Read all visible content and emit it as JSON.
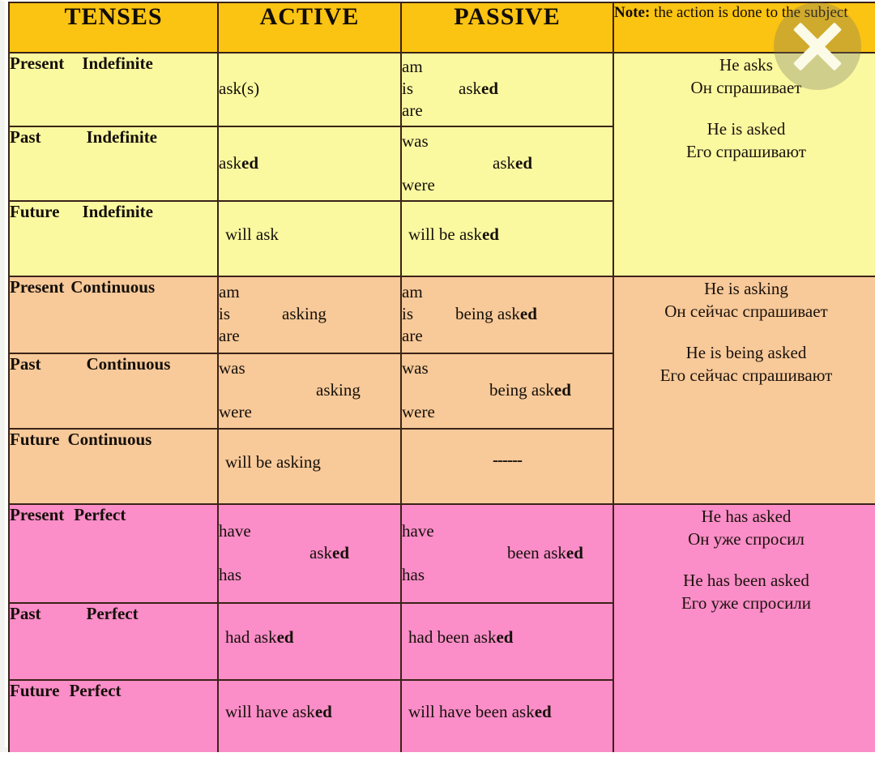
{
  "header": {
    "col_tenses": "TENSES",
    "col_active": "ACTIVE",
    "col_passive": "PASSIVE",
    "note_label": "Note:",
    "note_text": " the action is done to the subject"
  },
  "close_button": {
    "label": "×",
    "icon": "close-icon"
  },
  "colors": {
    "header_bg": "#fbc312",
    "indefinite_bg": "#fbf9a0",
    "continuous_bg": "#f8c999",
    "perfect_bg": "#fb8dc8",
    "border": "#3a2318",
    "text": "#15100a"
  },
  "sections": [
    {
      "id": "indefinite",
      "rows": [
        {
          "tense_a": "Present",
          "tense_b": "Indefinite",
          "active": {
            "lines": [
              "",
              "ask(s)",
              ""
            ],
            "aux": [
              "",
              "",
              ""
            ]
          },
          "passive": {
            "aux": [
              "am",
              "is",
              "are"
            ],
            "main": "asked",
            "main_line": 1
          }
        },
        {
          "tense_a": "Past",
          "tense_b": "Indefinite",
          "active": {
            "lines": [
              "",
              "asked",
              ""
            ],
            "aux": [
              "",
              "",
              ""
            ]
          },
          "passive": {
            "aux": [
              "was",
              "",
              "were"
            ],
            "main": "asked",
            "main_line": 1
          }
        },
        {
          "tense_a": "Future",
          "tense_b": "Indefinite",
          "active_single": "will ask",
          "passive_single": "will be   asked"
        }
      ],
      "note_lines": [
        "He asks",
        "Он спрашивает",
        "",
        "He is asked",
        "Его спрашивают"
      ]
    },
    {
      "id": "continuous",
      "rows": [
        {
          "tense_a": "Present",
          "tense_b": "Continuous",
          "active": {
            "aux": [
              "am",
              "is",
              "are"
            ],
            "main": "asking",
            "main_line": 1
          },
          "passive": {
            "aux": [
              "am",
              "is",
              "are"
            ],
            "main": "being asked",
            "main_line": 1
          }
        },
        {
          "tense_a": "Past",
          "tense_b": "Continuous",
          "active": {
            "aux": [
              "was",
              "",
              "were"
            ],
            "main": "asking",
            "main_line": 1
          },
          "passive": {
            "aux": [
              "was",
              "",
              "were"
            ],
            "main": "being asked",
            "main_line": 1
          }
        },
        {
          "tense_a": "Future",
          "tense_b": "Continuous",
          "active_single": "will be  asking",
          "passive_single": "------"
        }
      ],
      "note_lines": [
        "He is asking",
        "Он сейчас спрашивает",
        "",
        "He is being asked",
        "Его сейчас спрашивают"
      ]
    },
    {
      "id": "perfect",
      "rows": [
        {
          "tense_a": "Present",
          "tense_b": "Perfect",
          "active": {
            "aux": [
              "have",
              "",
              "has"
            ],
            "main": "asked",
            "main_line": 1
          },
          "passive": {
            "aux": [
              "have",
              "",
              "has"
            ],
            "main": "been  asked",
            "main_line": 1
          }
        },
        {
          "tense_a": "Past",
          "tense_b": "Perfect",
          "active_single": "had       asked",
          "passive_single": "had     been asked"
        },
        {
          "tense_a": "Future",
          "tense_b": "Perfect",
          "active_single": "will have asked",
          "passive_single": "will have been asked"
        }
      ],
      "note_lines": [
        "He has asked",
        "Он уже спросил",
        "",
        "He has been asked",
        "Его уже спросили"
      ]
    }
  ]
}
